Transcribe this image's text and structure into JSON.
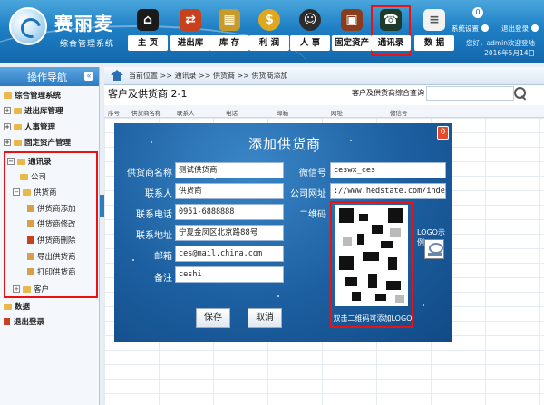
{
  "header": {
    "app_name": "赛丽麦",
    "app_subtitle": "综合管理系统",
    "nav": [
      {
        "label": "主 页",
        "icon": "home-icon"
      },
      {
        "label": "进出库",
        "icon": "inout-icon"
      },
      {
        "label": "库 存",
        "icon": "inventory-icon"
      },
      {
        "label": "利 润",
        "icon": "profit-icon"
      },
      {
        "label": "人 事",
        "icon": "personnel-icon"
      },
      {
        "label": "固定资产",
        "icon": "assets-icon"
      },
      {
        "label": "通讯录",
        "icon": "contacts-icon",
        "active": true
      },
      {
        "label": "数 据",
        "icon": "data-icon"
      }
    ],
    "system_settings": "系统设置",
    "logout": "退出登录",
    "greeting": "您好，admin欢迎登陆",
    "date": "2016年5月14日",
    "bell": "0"
  },
  "sidebar": {
    "title": "操作导航",
    "collapse": "«",
    "items": [
      {
        "label": "综合管理系统"
      },
      {
        "label": "进出库管理"
      },
      {
        "label": "人事管理"
      },
      {
        "label": "固定资产管理"
      },
      {
        "label": "通讯录"
      },
      {
        "label": "公司"
      },
      {
        "label": "供货商"
      },
      {
        "label": "供货商添加"
      },
      {
        "label": "供货商修改"
      },
      {
        "label": "供货商删除"
      },
      {
        "label": "导出供货商"
      },
      {
        "label": "打印供货商"
      },
      {
        "label": "客户"
      },
      {
        "label": "数据"
      },
      {
        "label": "退出登录"
      }
    ]
  },
  "main": {
    "breadcrumb": "当前位置 >> 通讯录 >> 供货商 >> 供货商添加",
    "title": "客户及供货商 2-1",
    "query_label": "客户及供货商综合查询",
    "columns": [
      "序号",
      "供货商名称",
      "联系人",
      "电话",
      "邮箱",
      "网址",
      "微信号"
    ]
  },
  "dialog": {
    "title": "添加供货商",
    "close": "0",
    "fields": {
      "name": {
        "label": "供货商名称",
        "value": "测试供货商"
      },
      "contact": {
        "label": "联系人",
        "value": "供货商"
      },
      "phone": {
        "label": "联系电话",
        "value": "0951-6888888"
      },
      "address": {
        "label": "联系地址",
        "value": "宁夏金凤区北京路88号"
      },
      "email": {
        "label": "邮箱",
        "value": "ces@mail.china.com"
      },
      "note": {
        "label": "备注",
        "value": "ceshi"
      },
      "wechat": {
        "label": "微信号",
        "value": "ceswx_ces"
      },
      "website": {
        "label": "公司网址",
        "value": "://www.hedstate.com/index.php"
      },
      "qrcode": {
        "label": "二维码"
      }
    },
    "qr_caption": "双击二维码可添加LOGO",
    "logo_label": "LOGO示例",
    "save": "保存",
    "cancel": "取消"
  },
  "colors": {
    "header_blue": "#1e7fc4",
    "highlight_red": "#ee1111",
    "dialog_blue": "#1c5fa0"
  }
}
